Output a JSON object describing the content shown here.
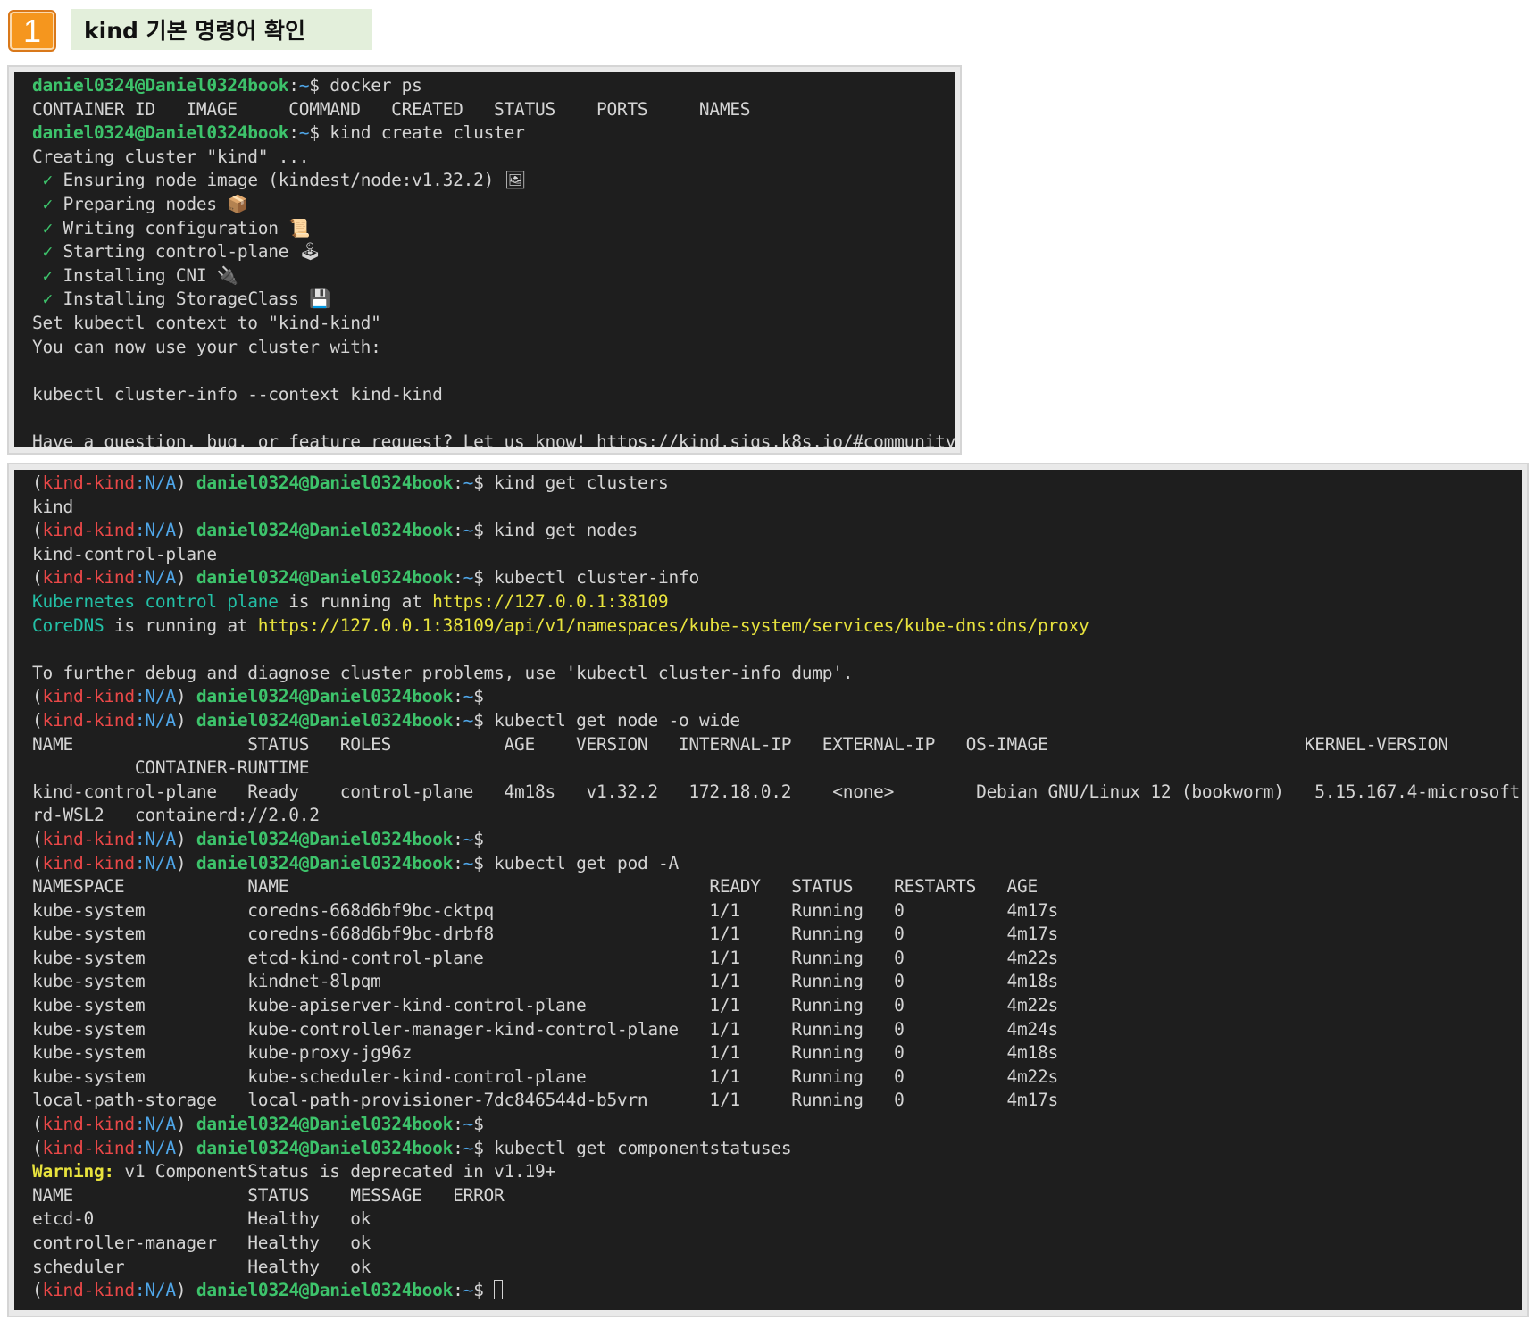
{
  "header": {
    "step_number": "1",
    "title": "kind 기본 명령어 확인"
  },
  "colors": {
    "terminal_bg": "#1e1e1e",
    "text": "#d4d4d4",
    "user_host": "#3dc36b",
    "path": "#4fa6e8",
    "kube_context": "#ea4848",
    "info_name": "#23c0a6",
    "url": "#e8e33d",
    "badge": "#f5961e",
    "title_bg": "#e3efdb"
  },
  "prompt": {
    "user_host": "daniel0324@Daniel0324book",
    "path": "~",
    "symbol": "$",
    "context_open": "(",
    "context": "kind-kind",
    "namespace": "N/A",
    "context_close": ")"
  },
  "terminal1": {
    "cmd_docker_ps": "docker ps",
    "docker_header": "CONTAINER ID   IMAGE     COMMAND   CREATED   STATUS    PORTS     NAMES",
    "cmd_create": "kind create cluster",
    "creating": "Creating cluster \"kind\" ...",
    "steps": [
      {
        "check": "✓",
        "text": "Ensuring node image (kindest/node:v1.32.2)",
        "emoji": "🖼"
      },
      {
        "check": "✓",
        "text": "Preparing nodes",
        "emoji": "📦"
      },
      {
        "check": "✓",
        "text": "Writing configuration",
        "emoji": "📜"
      },
      {
        "check": "✓",
        "text": "Starting control-plane",
        "emoji": "🕹"
      },
      {
        "check": "✓",
        "text": "Installing CNI",
        "emoji": "🔌"
      },
      {
        "check": "✓",
        "text": "Installing StorageClass",
        "emoji": "💾"
      }
    ],
    "set_context": "Set kubectl context to \"kind-kind\"",
    "use_cluster": "You can now use your cluster with:",
    "cluster_info_cmd": "kubectl cluster-info --context kind-kind",
    "feedback": "Have a question, bug, or feature request? Let us know! https://kind.sigs.k8s.io/#community",
    "feedback_emoji": "🙂"
  },
  "terminal2": {
    "cmd_get_clusters": "kind get clusters",
    "out_clusters": "kind",
    "cmd_get_nodes": "kind get nodes",
    "out_nodes": "kind-control-plane",
    "cmd_cluster_info": "kubectl cluster-info",
    "info_cp_name": "Kubernetes control plane",
    "info_cp_mid": " is running at ",
    "info_cp_url": "https://127.0.0.1:38109",
    "info_dns_name": "CoreDNS",
    "info_dns_mid": " is running at ",
    "info_dns_url": "https://127.0.0.1:38109/api/v1/namespaces/kube-system/services/kube-dns:dns/proxy",
    "debug_hint": "To further debug and diagnose cluster problems, use 'kubectl cluster-info dump'.",
    "cmd_get_node_wide": "kubectl get node -o wide",
    "node_header_1": "NAME                 STATUS   ROLES           AGE    VERSION   INTERNAL-IP   EXTERNAL-IP   OS-IMAGE                         KERNEL-VERSION",
    "node_header_2": "          CONTAINER-RUNTIME",
    "node_row_1": "kind-control-plane   Ready    control-plane   4m18s   v1.32.2   172.18.0.2    <none>        Debian GNU/Linux 12 (bookworm)   5.15.167.4-microsoft-standa",
    "node_row_2": "rd-WSL2   containerd://2.0.2",
    "cmd_get_pod": "kubectl get pod -A",
    "pod_header": "NAMESPACE            NAME                                         READY   STATUS    RESTARTS   AGE",
    "pods": [
      "kube-system          coredns-668d6bf9bc-cktpq                     1/1     Running   0          4m17s",
      "kube-system          coredns-668d6bf9bc-drbf8                     1/1     Running   0          4m17s",
      "kube-system          etcd-kind-control-plane                      1/1     Running   0          4m22s",
      "kube-system          kindnet-8lpqm                                1/1     Running   0          4m18s",
      "kube-system          kube-apiserver-kind-control-plane            1/1     Running   0          4m22s",
      "kube-system          kube-controller-manager-kind-control-plane   1/1     Running   0          4m24s",
      "kube-system          kube-proxy-jg96z                             1/1     Running   0          4m18s",
      "kube-system          kube-scheduler-kind-control-plane            1/1     Running   0          4m22s",
      "local-path-storage   local-path-provisioner-7dc846544d-b5vrn      1/1     Running   0          4m17s"
    ],
    "cmd_componentstatuses": "kubectl get componentstatuses",
    "warning_label": "Warning:",
    "warning_text": " v1 ComponentStatus is deprecated in v1.19+",
    "cs_header": "NAME                 STATUS    MESSAGE   ERROR",
    "cs_rows": [
      "etcd-0               Healthy   ok",
      "controller-manager   Healthy   ok",
      "scheduler            Healthy   ok"
    ]
  }
}
